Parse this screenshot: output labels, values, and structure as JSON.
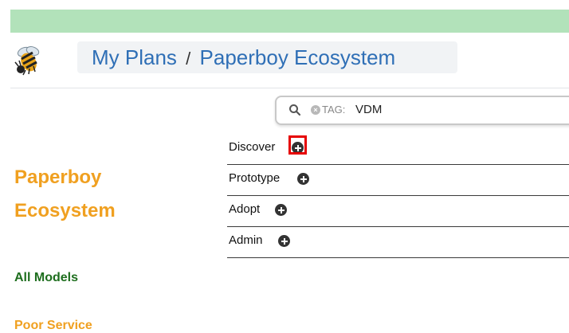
{
  "header": {
    "crumbs": [
      {
        "label": "My Plans"
      },
      {
        "separator": "/"
      },
      {
        "label": "Paperboy Ecosystem"
      }
    ]
  },
  "search": {
    "tag_key": "TAG:",
    "tag_value": "VDM"
  },
  "stages": [
    {
      "label": "Discover"
    },
    {
      "label": "Prototype"
    },
    {
      "label": "Adopt"
    },
    {
      "label": "Admin"
    }
  ],
  "sidebar": {
    "plan_title_line1": "Paperboy",
    "plan_title_line2": "Ecosystem",
    "nav": [
      {
        "label": "All Models"
      },
      {
        "label": "Poor Service"
      }
    ]
  },
  "colors": {
    "top_bar": "#b2e2ba",
    "link_blue": "#2f6fb6",
    "plan_orange": "#f0a020",
    "nav_green": "#1e6e1e",
    "highlight_red": "#e60000"
  },
  "icons": {
    "logo": "bee-icon",
    "search": "search-icon",
    "tag_remove": "close-circle-icon",
    "add": "plus-circle-icon"
  }
}
